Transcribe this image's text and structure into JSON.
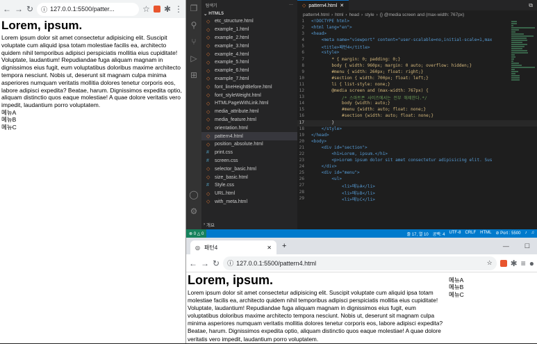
{
  "left_browser": {
    "url": "127.0.0.1:5500/patter...",
    "heading": "Lorem, ipsum.",
    "paragraph": "Lorem ipsum dolor sit amet consectetur adipisicing elit. Suscipit voluptate cum aliquid ipsa totam molestiae facilis ea, architecto quidem nihil temporibus adipisci perspiciatis mollitia eius cupiditate! Voluptate, laudantium! Repudiandae fuga aliquam magnam in dignissimos eius fugit, eum voluptatibus doloribus maxime architecto tempora nesciunt. Nobis ut, deserunt sit magnam culpa minima asperiores numquam veritatis mollitia dolores tenetur corporis eos, labore adipisci expedita? Beatae, harum. Dignissimos expedita optio, aliquam distinctio quos eaque molestiae! A quae dolore veritatis vero impedit, laudantium porro voluptatem.",
    "menu": [
      "메뉴A",
      "메뉴B",
      "메뉴C"
    ]
  },
  "explorer": {
    "title": "탐색기",
    "more": "···",
    "folder": "HTML5",
    "files": [
      {
        "name": "etc_structure.html",
        "type": "html"
      },
      {
        "name": "example_1.html",
        "type": "html"
      },
      {
        "name": "example_2.html",
        "type": "html"
      },
      {
        "name": "example_3.html",
        "type": "html"
      },
      {
        "name": "example_4.html",
        "type": "html"
      },
      {
        "name": "example_5.html",
        "type": "html"
      },
      {
        "name": "example_6.html",
        "type": "html"
      },
      {
        "name": "example_7.html",
        "type": "html"
      },
      {
        "name": "font_lineHeightBefore.html",
        "type": "html"
      },
      {
        "name": "font_styleWeight.html",
        "type": "html"
      },
      {
        "name": "HTMLPageWithLink.html",
        "type": "html"
      },
      {
        "name": "media_attribute.html",
        "type": "html"
      },
      {
        "name": "media_feature.html",
        "type": "html"
      },
      {
        "name": "orientation.html",
        "type": "html"
      },
      {
        "name": "pattern4.html",
        "type": "html",
        "selected": true
      },
      {
        "name": "position_absolute.html",
        "type": "html"
      },
      {
        "name": "print.css",
        "type": "css"
      },
      {
        "name": "screen.css",
        "type": "css"
      },
      {
        "name": "selector_basic.html",
        "type": "html"
      },
      {
        "name": "size_basic.html",
        "type": "html"
      },
      {
        "name": "Style.css",
        "type": "css"
      },
      {
        "name": "URL.html",
        "type": "html"
      },
      {
        "name": "with_meta.html",
        "type": "html"
      }
    ],
    "outline": "개요"
  },
  "editor": {
    "tab": "pattern4.html",
    "breadcrumb": [
      "pattern4.html",
      "html",
      "head",
      "style",
      "{} @media screen and (max-width: 767px)"
    ],
    "lines": [
      {
        "n": "1",
        "t": "<!DOCTYPE html>"
      },
      {
        "n": "2",
        "t": "<html lang=\"en\">"
      },
      {
        "n": "3",
        "t": "<head>"
      },
      {
        "n": "4",
        "t": "    <meta name=\"viewport\" content=\"user-scalable=no,initial-scale=1,max"
      },
      {
        "n": "5",
        "t": "    <title>패턴4</title>"
      },
      {
        "n": "6",
        "t": "    <style>"
      },
      {
        "n": "7",
        "t": "        * { margin: 0; padding: 0;}"
      },
      {
        "n": "8",
        "t": "        body { width: 960px; margin: 0 auto; overflow: hidden;}"
      },
      {
        "n": "9",
        "t": "        #menu { width: 260px; float: right;}"
      },
      {
        "n": "10",
        "t": "        #section { width: 700px; float: left;}"
      },
      {
        "n": "11",
        "t": "        li { list-style: none;}"
      },
      {
        "n": "12",
        "t": "        @media screen and (max-width: 767px) {"
      },
      {
        "n": "13",
        "t": "            /* 스마트폰 사이즈에서는 전부 해제한다.*/"
      },
      {
        "n": "14",
        "t": "            body {width: auto;}"
      },
      {
        "n": "15",
        "t": "            #menu {width: auto; float: none;}"
      },
      {
        "n": "16",
        "t": "            #section {width: auto; float: none;}"
      },
      {
        "n": "17",
        "t": "        }",
        "current": true
      },
      {
        "n": "18",
        "t": "    </style>"
      },
      {
        "n": "19",
        "t": "</head>"
      },
      {
        "n": "20",
        "t": "<body>"
      },
      {
        "n": "21",
        "t": "    <div id=\"section\">"
      },
      {
        "n": "22",
        "t": "        <h1>Lorem, ipsum.</h1>"
      },
      {
        "n": "23",
        "t": "        <p>Lorem ipsum dolor sit amet consectetur adipisicing elit. Sus"
      },
      {
        "n": "24",
        "t": "    </div>"
      },
      {
        "n": "25",
        "t": "    <div id=\"menu\">"
      },
      {
        "n": "26",
        "t": "        <ul>"
      },
      {
        "n": "27",
        "t": "            <li>메뉴A</li>"
      },
      {
        "n": "28",
        "t": "            <li>메뉴B</li>"
      },
      {
        "n": "29",
        "t": "            <li>메뉴C</li>"
      }
    ]
  },
  "status": {
    "errors": "⊗ 0 △ 0",
    "position": "줄 17, 열 10",
    "spaces": "공백: 4",
    "encoding": "UTF-8",
    "eol": "CRLF",
    "language": "HTML",
    "port": "⊘ Port : 5500"
  },
  "bottom_browser": {
    "tab_title": "패턴4",
    "new_tab": "+",
    "url": "127.0.0.1:5500/pattern4.html",
    "heading": "Lorem, ipsum.",
    "paragraph": "Lorem ipsum dolor sit amet consectetur adipisicing elit. Suscipit voluptate cum aliquid ipsa totam molestiae facilis ea, architecto quidem nihil temporibus adipisci perspiciatis mollitia eius cupiditate! Voluptate, laudantium! Repudiandae fuga aliquam magnam in dignissimos eius fugit, eum voluptatibus doloribus maxime architecto tempora nesciunt. Nobis ut, deserunt sit magnam culpa minima asperiores numquam veritatis mollitia dolores tenetur corporis eos, labore adipisci expedita? Beatae, harum. Dignissimos expedita optio, aliquam distinctio quos eaque molestiae! A quae dolore veritatis vero impedit, laudantium porro voluptatem.",
    "menu": [
      "메뉴A",
      "메뉴B",
      "메뉴C"
    ]
  }
}
